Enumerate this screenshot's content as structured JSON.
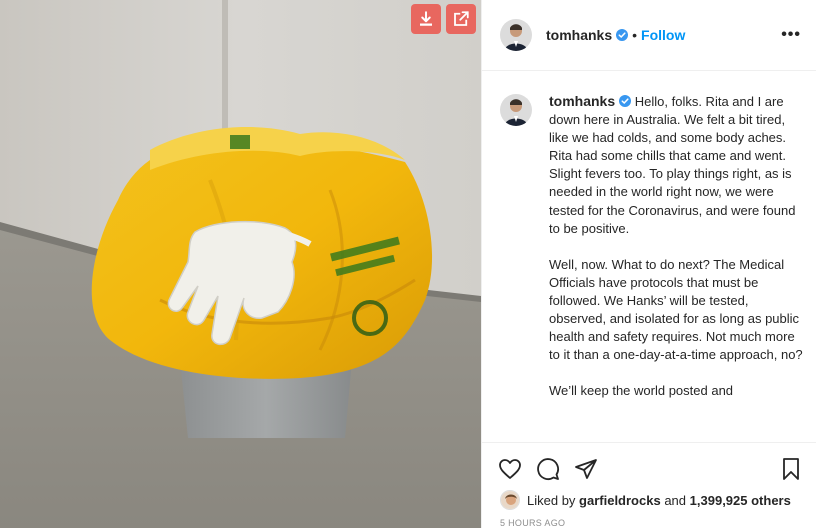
{
  "header": {
    "username": "tomhanks",
    "separator": "•",
    "follow_label": "Follow",
    "more_label": "•••"
  },
  "caption": {
    "username": "tomhanks",
    "paragraphs": [
      "Hello, folks. Rita and I are down here in Australia. We felt a bit tired, like we had colds, and some body aches. Rita had some chills that came and went. Slight fevers too. To play things right, as is needed in the world right now, we were tested for the Coronavirus, and were found to be positive.",
      "Well, now. What to do next? The Medical Officials have protocols that must be followed. We Hanks’ will be tested, observed, and isolated for as long as public health and safety requires. Not much more to it than a one-day-at-a-time approach, no?",
      "We’ll keep the world posted and"
    ]
  },
  "likes": {
    "prefix": "Liked by",
    "user": "garfieldrocks",
    "conj": "and",
    "count": "1,399,925 others"
  },
  "timestamp": "5 HOURS AGO",
  "icons": {
    "download": "download-icon",
    "open": "open-external-icon",
    "verified": "verified-badge-icon",
    "like": "heart-icon",
    "comment": "comment-icon",
    "share": "share-icon",
    "save": "bookmark-icon"
  },
  "colors": {
    "accent_follow": "#0095f6",
    "verified": "#3897f0",
    "ext_buttons": "#e8675f",
    "text": "#262626",
    "muted": "#8e8e8e"
  }
}
